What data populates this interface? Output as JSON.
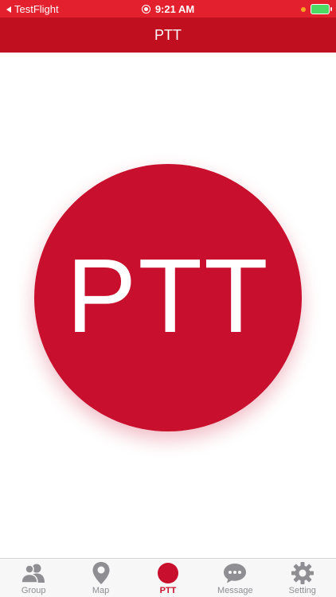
{
  "status_bar": {
    "back_label": "TestFlight",
    "time": "9:21 AM"
  },
  "nav": {
    "title": "PTT"
  },
  "main": {
    "ptt_button_label": "PTT"
  },
  "tabs": [
    {
      "label": "Group",
      "icon": "group-icon",
      "active": false
    },
    {
      "label": "Map",
      "icon": "map-pin-icon",
      "active": false
    },
    {
      "label": "PTT",
      "icon": "ptt-dot-icon",
      "active": true
    },
    {
      "label": "Message",
      "icon": "message-bubble-icon",
      "active": false
    },
    {
      "label": "Setting",
      "icon": "gear-icon",
      "active": false
    }
  ],
  "colors": {
    "status_bar": "#e3202d",
    "nav_bar": "#c0101f",
    "accent": "#c8102e",
    "inactive_tab": "#8e8e93"
  }
}
